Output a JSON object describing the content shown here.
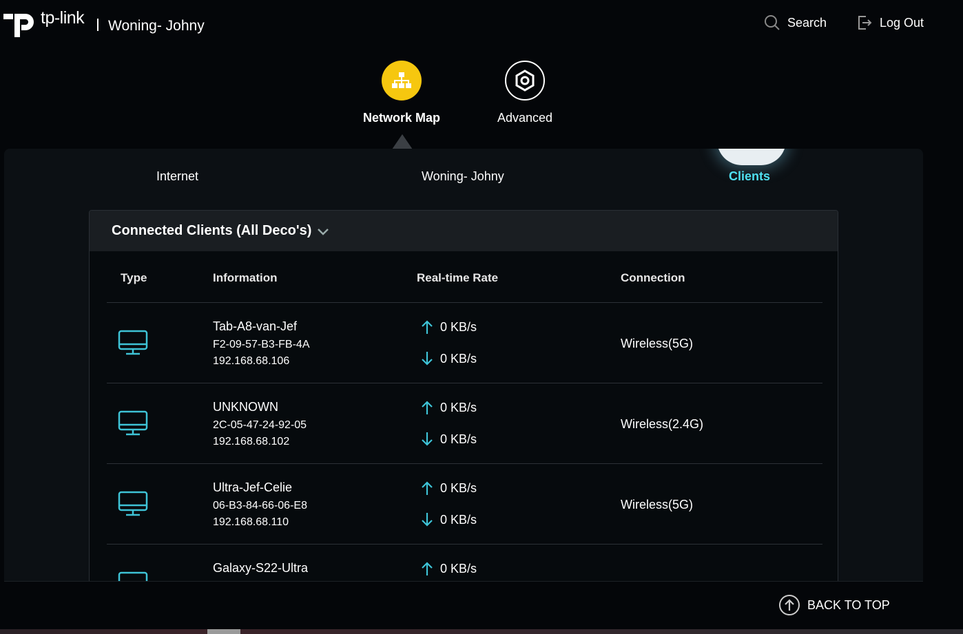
{
  "header": {
    "logo_text": "tp-link",
    "network_name": "Woning- Johny",
    "search_label": "Search",
    "logout_label": "Log Out"
  },
  "nav": {
    "items": [
      {
        "label": "Network Map",
        "icon": "network-map-icon",
        "active": true
      },
      {
        "label": "Advanced",
        "icon": "gear-icon",
        "active": false
      }
    ]
  },
  "subnav": {
    "items": [
      {
        "label": "Internet"
      },
      {
        "label": "Woning- Johny"
      },
      {
        "label": "Clients",
        "active": true
      }
    ]
  },
  "clients_table": {
    "title": "Connected Clients (All Deco's)",
    "columns": [
      "Type",
      "Information",
      "Real-time Rate",
      "Connection"
    ],
    "rows": [
      {
        "type_icon": "monitor-icon",
        "name": "Tab-A8-van-Jef",
        "mac": "F2-09-57-B3-FB-4A",
        "ip": "192.168.68.106",
        "upload": "0 KB/s",
        "download": "0 KB/s",
        "connection": "Wireless(5G)"
      },
      {
        "type_icon": "monitor-icon",
        "name": "UNKNOWN",
        "mac": "2C-05-47-24-92-05",
        "ip": "192.168.68.102",
        "upload": "0 KB/s",
        "download": "0 KB/s",
        "connection": "Wireless(2.4G)"
      },
      {
        "type_icon": "monitor-icon",
        "name": "Ultra-Jef-Celie",
        "mac": "06-B3-84-66-06-E8",
        "ip": "192.168.68.110",
        "upload": "0 KB/s",
        "download": "0 KB/s",
        "connection": "Wireless(5G)"
      },
      {
        "type_icon": "monitor-icon",
        "name": "Galaxy-S22-Ultra",
        "mac": "",
        "ip": "",
        "upload": "0 KB/s",
        "download": "",
        "connection": ""
      }
    ]
  },
  "footer": {
    "back_to_top_label": "BACK TO TOP"
  },
  "colors": {
    "accent_cyan": "#4fe0f0",
    "icon_cyan": "#3ec3d6",
    "active_yellow": "#f6c70f",
    "background": "#040609"
  }
}
